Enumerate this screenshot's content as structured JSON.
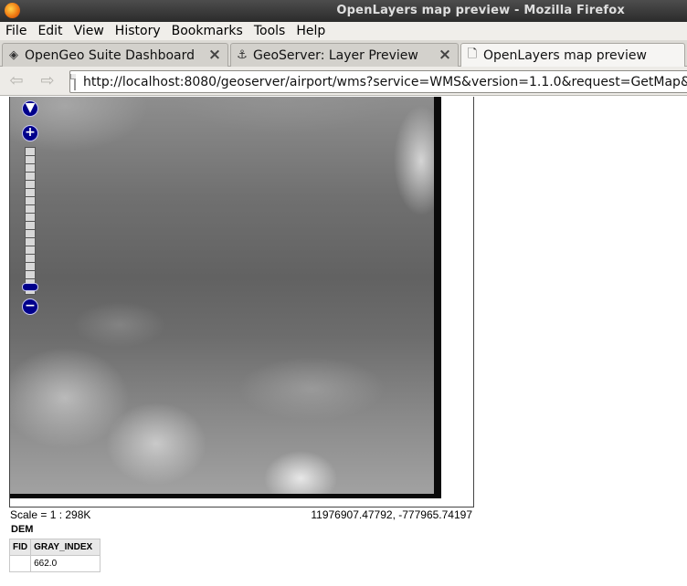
{
  "window": {
    "title": "OpenLayers map preview - Mozilla Firefox"
  },
  "menubar": {
    "items": [
      "File",
      "Edit",
      "View",
      "History",
      "Bookmarks",
      "Tools",
      "Help"
    ]
  },
  "tabs": [
    {
      "label": "OpenGeo Suite Dashboard",
      "icon": "opengeo-icon"
    },
    {
      "label": "GeoServer: Layer Preview",
      "icon": "geoserver-icon"
    },
    {
      "label": "OpenLayers map preview",
      "icon": "page-icon"
    }
  ],
  "navbar": {
    "url": "http://localhost:8080/geoserver/airport/wms?service=WMS&version=1.1.0&request=GetMap&layers"
  },
  "map": {
    "zoom_in_label": "+",
    "zoom_out_label": "−",
    "pan_label": "▼",
    "scale": "Scale = 1 : 298K",
    "coordinates": "11976907.47792, -777965.74197"
  },
  "feature_info": {
    "layer": "DEM",
    "columns": [
      "FID",
      "GRAY_INDEX"
    ],
    "rows": [
      [
        "",
        "662.0"
      ]
    ]
  }
}
